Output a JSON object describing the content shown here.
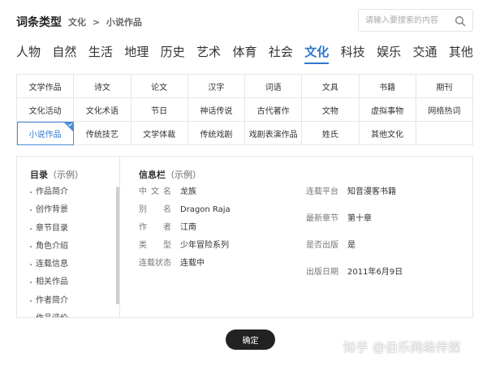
{
  "header": {
    "title": "词条类型",
    "breadcrumb": [
      "文化",
      ">",
      "小说作品"
    ]
  },
  "search": {
    "placeholder": "请输入要搜索的内容",
    "icon": "search-icon"
  },
  "categories": [
    "人物",
    "自然",
    "生活",
    "地理",
    "历史",
    "艺术",
    "体育",
    "社会",
    "文化",
    "科技",
    "娱乐",
    "交通",
    "其他"
  ],
  "active_category": "文化",
  "subcategories": [
    "文学作品",
    "诗文",
    "论文",
    "汉字",
    "词语",
    "文具",
    "书籍",
    "期刊",
    "文化活动",
    "文化术语",
    "节日",
    "神话传说",
    "古代著作",
    "文物",
    "虚拟事物",
    "网络热词",
    "小说作品",
    "传统技艺",
    "文学体裁",
    "传统戏剧",
    "戏剧表演作品",
    "姓氏",
    "其他文化",
    ""
  ],
  "active_subcategory": "小说作品",
  "accent_color": "#2f77d1",
  "toc": {
    "heading": "目录",
    "heading_sub": "（示例）",
    "items": [
      "作品简介",
      "创作背景",
      "章节目录",
      "角色介绍",
      "连载信息",
      "相关作品",
      "作者简介",
      "作品评价"
    ]
  },
  "info": {
    "heading": "信息栏",
    "heading_sub": "（示例）",
    "left": [
      {
        "label": "中文名",
        "value": "龙族"
      },
      {
        "label": "别名",
        "value": "Dragon Raja"
      },
      {
        "label": "作者",
        "value": "江南"
      },
      {
        "label": "类型",
        "value": "少年冒险系列"
      },
      {
        "label": "连载状态",
        "value": "连载中"
      }
    ],
    "right": [
      {
        "label": "连载平台",
        "value": "知音漫客书籍"
      },
      {
        "label": "最新章节",
        "value": "第十章"
      },
      {
        "label": "是否出版",
        "value": "是"
      },
      {
        "label": "出版日期",
        "value": "2011年6月9日"
      }
    ]
  },
  "footer": {
    "confirm_label": "确定",
    "watermark": "知乎 @伯乐网络传媒"
  }
}
